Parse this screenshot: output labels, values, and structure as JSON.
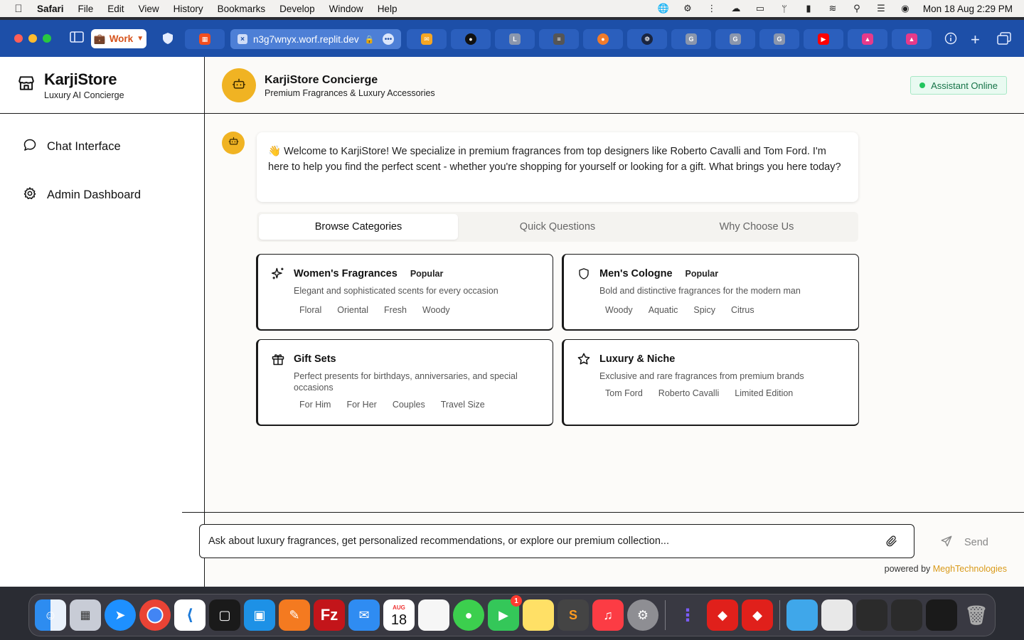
{
  "menubar": {
    "app": "Safari",
    "items": [
      "File",
      "Edit",
      "View",
      "History",
      "Bookmarks",
      "Develop",
      "Window",
      "Help"
    ],
    "clock": "Mon 18 Aug  2:29 PM"
  },
  "browser": {
    "profile_label": "Work",
    "url": "n3g7wnyx.worf.replit.dev",
    "tab_letters": [
      "L",
      "G",
      "G",
      "G"
    ]
  },
  "sidebar": {
    "brand_name": "KarjiStore",
    "brand_tagline": "Luxury AI Concierge",
    "nav": [
      {
        "label": "Chat Interface",
        "icon": "chat-bubble-icon"
      },
      {
        "label": "Admin Dashboard",
        "icon": "gear-icon"
      }
    ]
  },
  "header": {
    "title": "KarjiStore Concierge",
    "subtitle": "Premium Fragrances & Luxury Accessories",
    "status": "Assistant Online"
  },
  "welcome": {
    "emoji": "👋",
    "text": "Welcome to KarjiStore! We specialize in premium fragrances from top designers like Roberto Cavalli and Tom Ford. I'm here to help you find the perfect scent - whether you're shopping for yourself or looking for a gift. What brings you here today?"
  },
  "tabs": {
    "browse": "Browse Categories",
    "quick": "Quick Questions",
    "why": "Why Choose Us"
  },
  "categories": [
    {
      "title": "Women's Fragrances",
      "badge": "Popular",
      "desc": "Elegant and sophisticated scents for every occasion",
      "tags": [
        "Floral",
        "Oriental",
        "Fresh",
        "Woody"
      ],
      "icon": "sparkles-icon"
    },
    {
      "title": "Men's Cologne",
      "badge": "Popular",
      "desc": "Bold and distinctive fragrances for the modern man",
      "tags": [
        "Woody",
        "Aquatic",
        "Spicy",
        "Citrus"
      ],
      "icon": "shield-icon"
    },
    {
      "title": "Gift Sets",
      "badge": "",
      "desc": "Perfect presents for birthdays, anniversaries, and special occasions",
      "tags": [
        "For Him",
        "For Her",
        "Couples",
        "Travel Size"
      ],
      "icon": "gift-icon"
    },
    {
      "title": "Luxury & Niche",
      "badge": "",
      "desc": "Exclusive and rare fragrances from premium brands",
      "tags": [
        "Tom Ford",
        "Roberto Cavalli",
        "Limited Edition"
      ],
      "icon": "star-icon"
    }
  ],
  "composer": {
    "placeholder": "Ask about luxury fragrances, get personalized recommendations, or explore our premium collection...",
    "send_label": "Send",
    "powered_prefix": "powered by ",
    "powered_brand": "MeghTechnologies"
  },
  "dock": {
    "calendar_month": "AUG",
    "calendar_day": "18",
    "facetime_badge": "1"
  },
  "colors": {
    "accent_gold": "#f0b323",
    "online_green": "#22c55e",
    "safari_blue": "#1d4fa8",
    "powered_brand": "#d99a1a"
  }
}
